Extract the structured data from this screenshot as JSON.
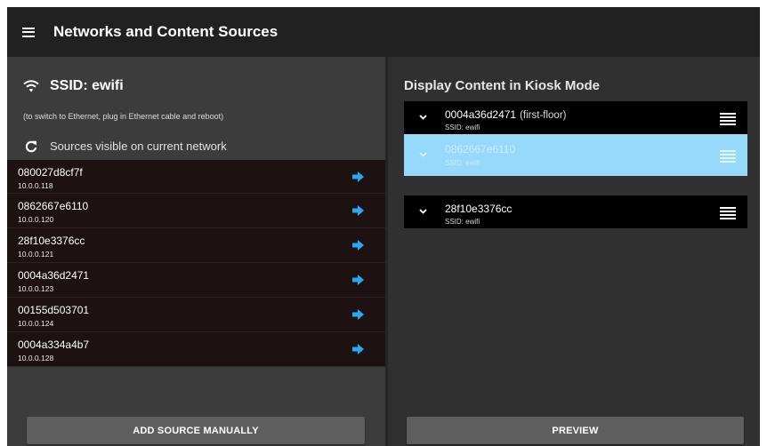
{
  "app": {
    "title": "Networks and Content Sources",
    "menu_icon": "menu-icon"
  },
  "network": {
    "ssid_label": "SSID: ewifi",
    "ethernet_hint": "(to switch to Ethernet, plug in Ethernet cable and reboot)",
    "sources_title": "Sources visible on current network"
  },
  "sources": [
    {
      "name": "080027d8cf7f",
      "ip": "10.0.0.118"
    },
    {
      "name": "0862667e6110",
      "ip": "10.0.0.120"
    },
    {
      "name": "28f10e3376cc",
      "ip": "10.0.0.121"
    },
    {
      "name": "0004a36d2471",
      "ip": "10.0.0.123"
    },
    {
      "name": "00155d503701",
      "ip": "10.0.0.124"
    },
    {
      "name": "0004a334a4b7",
      "ip": "10.0.0.128"
    }
  ],
  "buttons": {
    "add_source": "ADD SOURCE MANUALLY",
    "preview": "PREVIEW"
  },
  "kiosk": {
    "title": "Display Content in Kiosk Mode",
    "items": [
      {
        "name": "0004a36d2471",
        "note": "(first-floor)",
        "ssid": "SSID: ewifi"
      },
      {
        "name": "0862667e6110",
        "note": "",
        "ssid": "SSID: ewifi"
      },
      {
        "name": "28f10e3376cc",
        "note": "",
        "ssid": "SSID: ewifi"
      }
    ]
  },
  "colors": {
    "appbar": "#212121",
    "left_panel": "#3c3c3c",
    "right_panel": "#303030",
    "list_row": "#1d1111",
    "selected_row": "#96d9fa",
    "accent_arrow": "#29a8f0",
    "button": "#5e5e5e"
  }
}
